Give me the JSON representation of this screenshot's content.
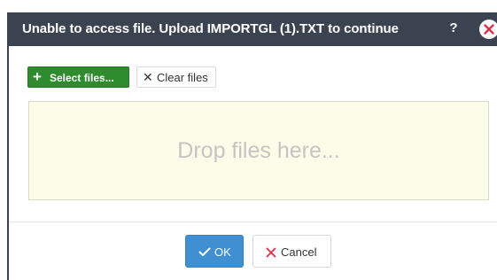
{
  "dialog": {
    "title": "Unable to access file. Upload IMPORTGL (1).TXT to continue",
    "help_label": "?",
    "close_icon": "close-circle-icon"
  },
  "toolbar": {
    "select_files_label": "Select files...",
    "select_files_icon": "plus-icon",
    "clear_files_label": "Clear files",
    "clear_files_icon": "x-icon"
  },
  "dropzone": {
    "placeholder": "Drop files here..."
  },
  "footer": {
    "ok_label": "OK",
    "ok_icon": "checkmark-icon",
    "cancel_label": "Cancel",
    "cancel_icon": "x-icon"
  },
  "colors": {
    "titlebar": "#3b4350",
    "select_button": "#2e8b2e",
    "ok_button": "#3f8fd2",
    "close_icon": "#e0304a",
    "cancel_icon": "#e0304a",
    "dropzone_bg": "#fcfde8"
  }
}
